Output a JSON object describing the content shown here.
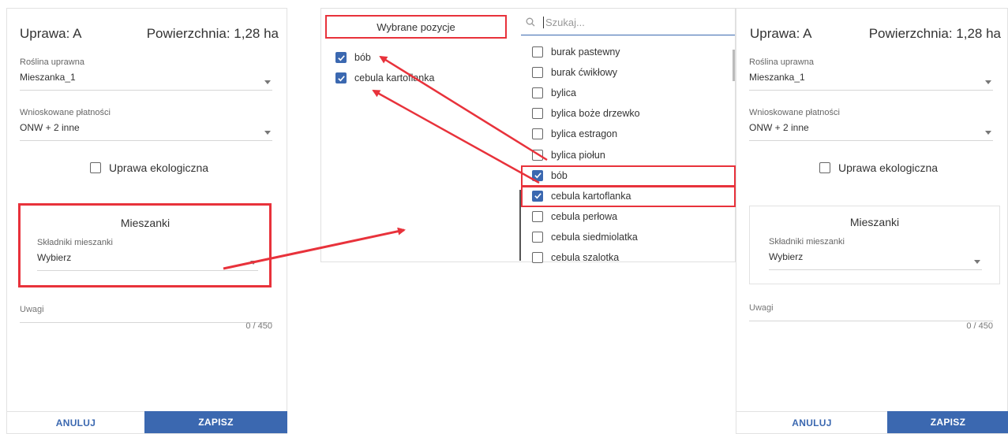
{
  "left_form": {
    "crop_label": "Uprawa: A",
    "area_label": "Powierzchnia: 1,28 ha",
    "plant_label": "Roślina uprawna",
    "plant_value": "Mieszanka_1",
    "payments_label": "Wnioskowane płatności",
    "payments_value": "ONW + 2 inne",
    "eco_label": "Uprawa ekologiczna",
    "mix_title": "Mieszanki",
    "mix_components_label": "Składniki mieszanki",
    "mix_components_value": "Wybierz",
    "notes_label": "Uwagi",
    "notes_counter": "0 / 450",
    "cancel_label": "ANULUJ",
    "save_label": "ZAPISZ"
  },
  "selector": {
    "selected_header": "Wybrane pozycje",
    "selected_items": [
      "bób",
      "cebula kartoflanka"
    ],
    "search_placeholder": "Szukaj...",
    "options": [
      {
        "label": "burak pastewny",
        "checked": false
      },
      {
        "label": "burak ćwikłowy",
        "checked": false
      },
      {
        "label": "bylica",
        "checked": false
      },
      {
        "label": "bylica boże drzewko",
        "checked": false
      },
      {
        "label": "bylica estragon",
        "checked": false
      },
      {
        "label": "bylica piołun",
        "checked": false
      },
      {
        "label": "bób",
        "checked": true
      },
      {
        "label": "cebula kartoflanka",
        "checked": true
      },
      {
        "label": "cebula perłowa",
        "checked": false
      },
      {
        "label": "cebula siedmiolatka",
        "checked": false
      },
      {
        "label": "cebula szalotka",
        "checked": false
      }
    ]
  },
  "right_form": {
    "crop_label": "Uprawa: A",
    "area_label": "Powierzchnia: 1,28 ha",
    "plant_label": "Roślina uprawna",
    "plant_value": "Mieszanka_1",
    "payments_label": "Wnioskowane płatności",
    "payments_value": "ONW + 2 inne",
    "eco_label": "Uprawa ekologiczna",
    "mix_title": "Mieszanki",
    "mix_components_label": "Składniki mieszanki",
    "mix_components_value": "Wybierz",
    "notes_label": "Uwagi",
    "notes_counter": "0 / 450",
    "cancel_label": "ANULUJ",
    "save_label": "ZAPISZ"
  },
  "colors": {
    "accent": "#3b68b0",
    "highlight": "#e8323b"
  }
}
